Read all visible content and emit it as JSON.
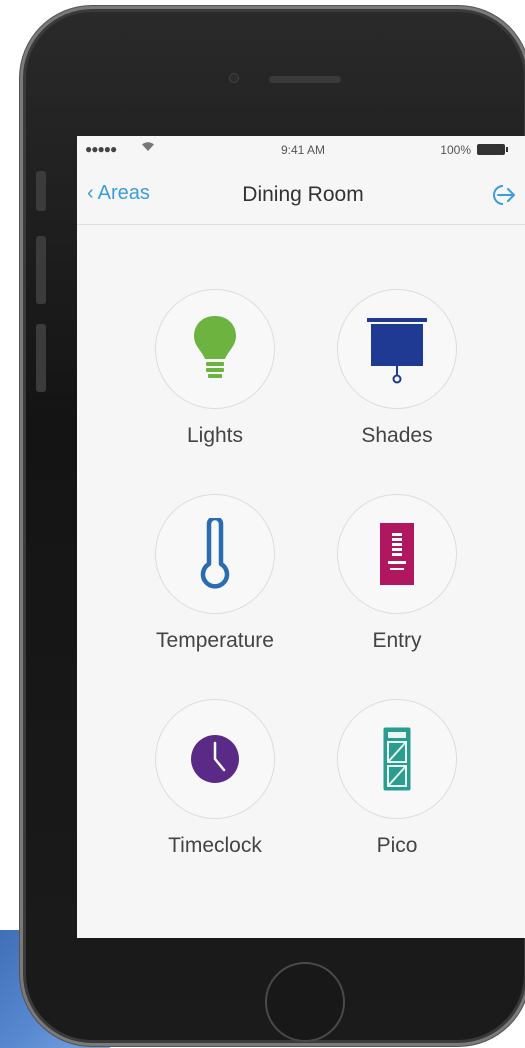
{
  "status": {
    "signal": "●●●●●",
    "time": "9:41 AM",
    "battery": "100%"
  },
  "nav": {
    "back_label": "Areas",
    "title": "Dining Room",
    "exit_icon": "exit-icon"
  },
  "tiles": [
    {
      "label": "Lights",
      "icon": "lightbulb-icon",
      "color": "#6cb33f"
    },
    {
      "label": "Shades",
      "icon": "shade-icon",
      "color": "#1f3a93"
    },
    {
      "label": "Temperature",
      "icon": "thermometer-icon",
      "color": "#2b6cb0"
    },
    {
      "label": "Entry",
      "icon": "keypad-icon",
      "color": "#b0175f"
    },
    {
      "label": "Timeclock",
      "icon": "clock-icon",
      "color": "#5b2a86"
    },
    {
      "label": "Pico",
      "icon": "pico-remote-icon",
      "color": "#2a9d8f"
    }
  ],
  "colors": {
    "accent": "#3a9fd8",
    "screen_bg": "#f6f6f6"
  }
}
